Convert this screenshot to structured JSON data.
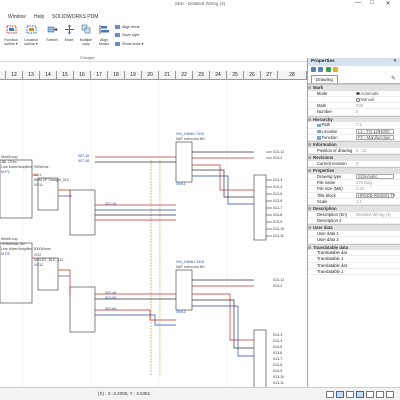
{
  "app": {
    "title": "SEE - Detailed Wiring (4)",
    "window_buttons": [
      "—",
      "□",
      "✕"
    ]
  },
  "menu": [
    "Window",
    "Help",
    "SOLIDWORKS PDM"
  ],
  "ribbon": {
    "buttons": [
      {
        "label": "Function outline ▾",
        "icon": "function-outline-icon"
      },
      {
        "label": "Location outline ▾",
        "icon": "location-outline-icon"
      },
      {
        "label": "Stretch",
        "icon": "stretch-icon"
      },
      {
        "label": "Move",
        "icon": "move-icon"
      },
      {
        "label": "Multiple copy",
        "icon": "multiple-copy-icon"
      },
      {
        "label": "Align blocks",
        "icon": "align-blocks-icon"
      }
    ],
    "small": [
      "Align texts",
      "Save style",
      "Show texts ▾"
    ],
    "group_label": "Changes"
  },
  "ruler": [
    "12",
    "13",
    "14",
    "15",
    "16",
    "17",
    "18",
    "19",
    "20",
    "21",
    "22",
    "23",
    "24",
    "25",
    "26",
    "27",
    "28"
  ],
  "status": {
    "coords": "(X) : X -3.2000, Y : 3.5351"
  },
  "properties": {
    "header": "Properties",
    "tab": "Drawing",
    "categories": [
      {
        "name": "Mark",
        "rows": [
          {
            "name": "Mode",
            "value": "Automatic",
            "value2": "Manual",
            "kind": "radio"
          },
          {
            "name": "Mark",
            "value": "008",
            "kind": "text"
          },
          {
            "name": "Number",
            "value": "5",
            "kind": "text"
          }
        ]
      },
      {
        "name": "Hierarchy",
        "rows": [
          {
            "name": "Path",
            "value": "7.5",
            "kind": "text"
          },
          {
            "name": "Location",
            "value": "L1 - TO 1294000",
            "kind": "box"
          },
          {
            "name": "Function",
            "value": "F1 - Manifunction",
            "kind": "box"
          }
        ]
      },
      {
        "name": "Information",
        "rows": [
          {
            "name": "Position of drawing",
            "value": "0 , 12",
            "kind": "text"
          }
        ]
      },
      {
        "name": "Revisions",
        "rows": [
          {
            "name": "Current revision",
            "value": "0",
            "kind": "text"
          }
        ]
      },
      {
        "name": "Properties",
        "rows": [
          {
            "name": "Drawing type",
            "value": "Schematic",
            "kind": "box"
          },
          {
            "name": "File name",
            "value": "175.dwg",
            "kind": "text"
          },
          {
            "name": "File size (MB)",
            "value": "0.20",
            "kind": "text"
          },
          {
            "name": "Title block",
            "value": "HRSDB-RMSM1 TT",
            "kind": "box"
          },
          {
            "name": "Scale",
            "value": "1:1",
            "kind": "text"
          }
        ]
      },
      {
        "name": "Description",
        "rows": [
          {
            "name": "Description (En)",
            "value": "Detailed Wiring (4)",
            "kind": "text"
          },
          {
            "name": "Description 2",
            "value": "",
            "kind": "text"
          }
        ]
      },
      {
        "name": "User data",
        "rows": [
          {
            "name": "User data 1",
            "value": "",
            "kind": "text"
          },
          {
            "name": "User data 2",
            "value": "",
            "kind": "text"
          }
        ]
      },
      {
        "name": "Translatable data",
        "rows": [
          {
            "name": "Translatable dat",
            "value": "",
            "kind": "text"
          },
          {
            "name": "Translatable 1",
            "value": "",
            "kind": "text"
          },
          {
            "name": "Translatable dat",
            "value": "",
            "kind": "text"
          },
          {
            "name": "Translatable 1",
            "value": "",
            "kind": "text"
          }
        ]
      }
    ]
  },
  "schematic": {
    "left_blocks": [
      {
        "name": "MiniGroup",
        "sub": "JBL 2Gbx",
        "desc": "Line Mixer/amplifier 750Wrms",
        "tag": "M-P2"
      },
      {
        "name": "MiniGroup",
        "sub": "TERMINAL 3G",
        "desc": "Line Mixer/Amplifier 3000Wrms",
        "tag": "M-P5"
      }
    ],
    "mid_blocks": [
      {
        "name": "XG1",
        "desc": "6MM 2P Straight_012",
        "tag": "XG11"
      },
      {
        "name": "XG2",
        "desc": "MOLEX_BLK_012",
        "tag": "XG12"
      }
    ],
    "right_blocks": [
      {
        "name": "XW_CMMU 7010",
        "desc": "NAT Interconn 6H",
        "tag": "XW11"
      },
      {
        "name": "XW_CMMU 3415",
        "desc": "NAT Interconn 6H",
        "tag": "XW12"
      }
    ],
    "wire_labels": [
      "007-16",
      "007-36",
      "007-26",
      "007-46",
      "007-56",
      "007-66"
    ],
    "terms_top": [
      "013-12",
      "013-2",
      "013-3",
      "013-4",
      "013-5",
      "013-6",
      "013-7",
      "013-8",
      "013-9",
      "013-10",
      "013-11"
    ],
    "terms_bottom": [
      "013-12",
      "013-2",
      "013-3",
      "013-4",
      "013-5",
      "013-6",
      "013-7",
      "013-8",
      "013-9",
      "013-10",
      "013-11"
    ]
  }
}
